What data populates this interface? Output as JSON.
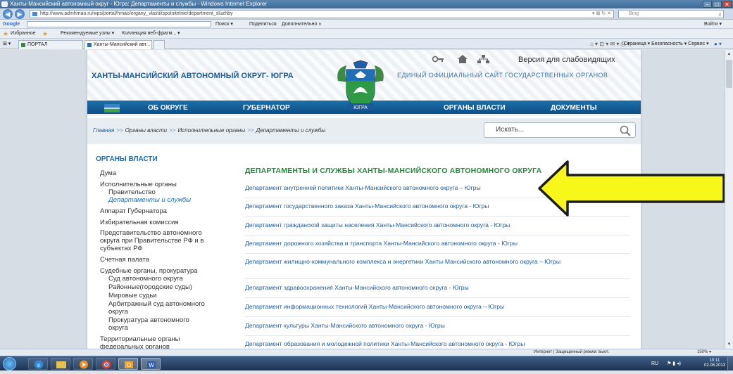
{
  "window": {
    "title": "Ханты-Мансийский автономный округ - Югра: Департаменты и службы - Windows Internet Explorer",
    "min": "–",
    "max": "□",
    "close": "✕"
  },
  "browser": {
    "address": "http://www.admhmao.ru/wps/portal/hmao/organy_vlasti/ispolnitelnie/department_sluzhby",
    "address_controls": "▾ ⊠ ↻ ✕",
    "bing_placeholder": "Bing",
    "google_label": "Google",
    "google_items": [
      "Поиск ▾",
      "Поделиться",
      "Дополнительно »"
    ],
    "google_signin": "Войти ▾",
    "favorites": {
      "label": "Избранное",
      "items": [
        "Рекомендуемые узлы ▾",
        "Коллекция веб-фрагм... ▾"
      ]
    },
    "tabs": [
      {
        "label": "ПОРТАЛ"
      },
      {
        "label": "Ханты-Мансийский авт..."
      }
    ],
    "command_bar": "Страница ▾   Безопасность ▾   Сервис ▾"
  },
  "site": {
    "title": "ХАНТЫ-МАНСИЙСКИЙ АВТОНОМНЫЙ ОКРУГ- ЮГРА",
    "official": "ЕДИНЫЙ ОФИЦИАЛЬНЫЙ САЙТ ГОСУДАРСТВЕННЫХ ОРГАНОВ",
    "version": "Версия для слабовидящих",
    "emblem_text": "ЮГРА",
    "nav": [
      "ОБ ОКРУГЕ",
      "ГУБЕРНАТОР",
      "ОРГАНЫ ВЛАСТИ",
      "ДОКУМЕНТЫ"
    ],
    "breadcrumb": {
      "home": "Главная",
      "sep": ">>",
      "level1": "Органы власти",
      "level2": "Исполнительные органы",
      "current": "Департаменты и службы"
    },
    "search_placeholder": "Искать..."
  },
  "sidebar": {
    "title": "ОРГАНЫ ВЛАСТИ",
    "items": [
      "Дума",
      "Исполнительные органы",
      "Правительство",
      "Департаменты и службы",
      "Аппарат Губернатора",
      "Избирательная комиссия",
      "Представительство автономного",
      "округа при Правительстве РФ и в",
      "субъектах РФ",
      "Счетная палата",
      "Судебные органы, прокуратура",
      "Суд автономного округа",
      "Районные(городские суды)",
      "Мировые судьи",
      "Арбитражный суд автономного",
      "округа",
      "Прокуратура автономного",
      "округа",
      "Территориальные органы",
      "федеральных органов"
    ]
  },
  "content": {
    "title": "ДЕПАРТАМЕНТЫ И СЛУЖБЫ ХАНТЫ-МАНСИЙСКОГО АВТОНОМНОГО ОКРУГА",
    "departments": [
      "Департамент внутренней политики Ханты-Мансийского автономного округа – Югры",
      "Департамент государственного заказа Ханты-Мансийского автономного округа - Югры",
      "Департамент гражданской защиты населения Ханты-Мансийского автономного округа - Югры",
      "Департамент дорожного хозяйства и транспорта Ханты-Мансийского автономного округа - Югры",
      "Департамент жилищно-коммунального комплекса и энергетики Ханты-Мансийского автономного округа – Югры",
      "Департамент здравоохранения Ханты-Мансийского автономного округа - Югры",
      "Департамент информационных технологий Ханты-Мансийского автономного округа – Югры",
      "Департамент культуры Ханты-Мансийского автономного округа - Югры",
      "Департамент образования и молодежной политики Ханты-Мансийского автономного округа - Югры"
    ]
  },
  "statusbar": {
    "security": "Интернет | Защищенный режим: выкл.",
    "zoom": "150% ▾"
  },
  "taskbar": {
    "lang": "RU",
    "time": "10:11",
    "date": "02.08.2013"
  },
  "colors": {
    "nav_blue": "#0c4f86",
    "title_blue": "#1d5a92",
    "green_heading": "#27883a",
    "arrow_yellow": "#f7f71a"
  }
}
